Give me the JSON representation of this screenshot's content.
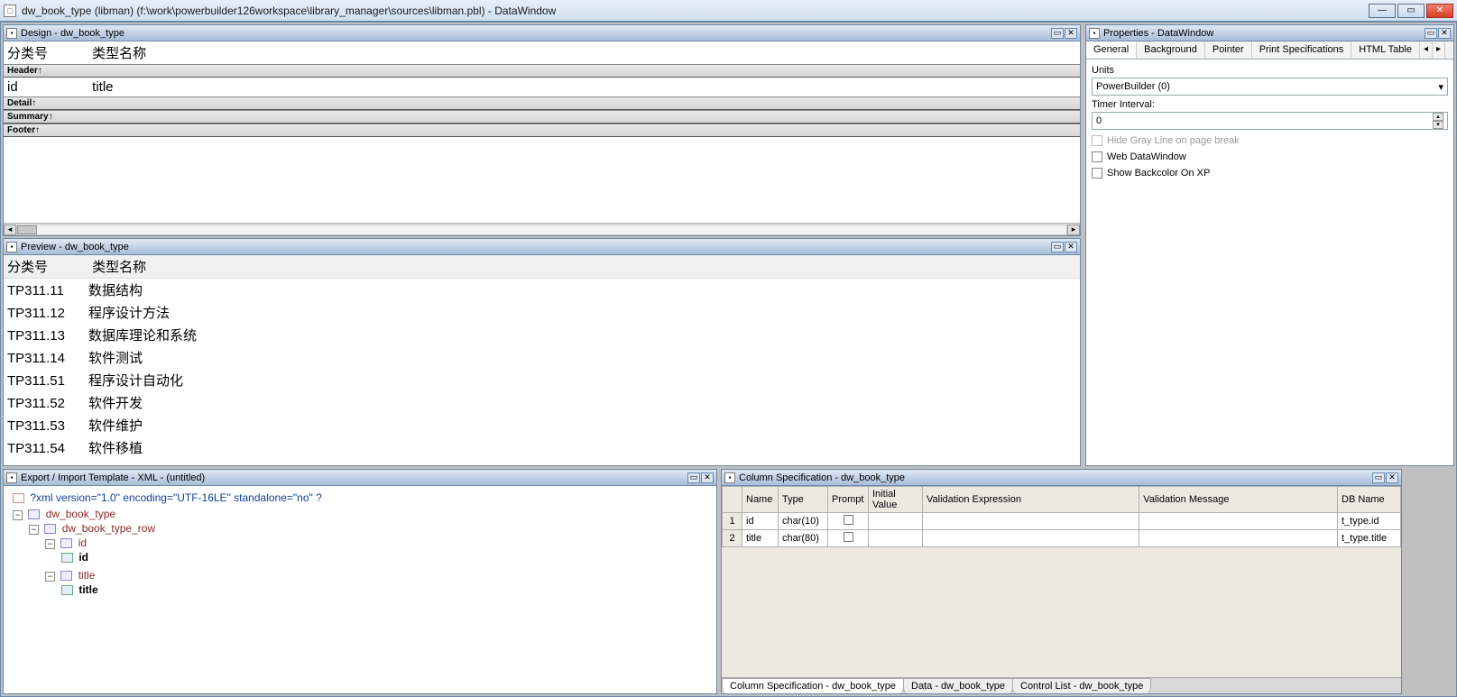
{
  "titlebar": {
    "title": "dw_book_type  (libman) (f:\\work\\powerbuilder126workspace\\library_manager\\sources\\libman.pbl) - DataWindow"
  },
  "design": {
    "panel_title": "Design - dw_book_type",
    "header": {
      "col1": "分类号",
      "col2": "类型名称"
    },
    "detail": {
      "col1": "id",
      "col2": "title"
    },
    "bands": {
      "header": "Header↑",
      "detail": "Detail↑",
      "summary": "Summary↑",
      "footer": "Footer↑"
    }
  },
  "preview": {
    "panel_title": "Preview - dw_book_type",
    "header": {
      "col1": "分类号",
      "col2": "类型名称"
    },
    "rows": [
      {
        "id": "TP311.11",
        "title": "数据结构"
      },
      {
        "id": "TP311.12",
        "title": "程序设计方法"
      },
      {
        "id": "TP311.13",
        "title": "数据库理论和系统"
      },
      {
        "id": "TP311.14",
        "title": "软件测试"
      },
      {
        "id": "TP311.51",
        "title": "程序设计自动化"
      },
      {
        "id": "TP311.52",
        "title": "软件开发"
      },
      {
        "id": "TP311.53",
        "title": "软件维护"
      },
      {
        "id": "TP311.54",
        "title": "软件移植"
      }
    ]
  },
  "properties": {
    "panel_title": "Properties - DataWindow",
    "tabs": {
      "general": "General",
      "background": "Background",
      "pointer": "Pointer",
      "print": "Print Specifications",
      "html": "HTML Table"
    },
    "units_label": "Units",
    "units_value": "PowerBuilder (0)",
    "timer_label": "Timer Interval:",
    "timer_value": "0",
    "hide_gray": "Hide Gray Line on page break",
    "web_dw": "Web DataWindow",
    "show_back": "Show Backcolor On XP"
  },
  "xml_panel": {
    "panel_title": "Export / Import Template - XML - (untitled)",
    "decl": "?xml version=\"1.0\" encoding=\"UTF-16LE\" standalone=\"no\" ?",
    "root": "dw_book_type",
    "row": "dw_book_type_row",
    "col1": "id",
    "col1_val": "id",
    "col2": "title",
    "col2_val": "title"
  },
  "colspec": {
    "panel_title": "Column Specification - dw_book_type",
    "headers": {
      "num": "",
      "name": "Name",
      "type": "Type",
      "prompt": "Prompt",
      "initial": "Initial Value",
      "validexpr": "Validation Expression",
      "validmsg": "Validation Message",
      "dbname": "DB Name"
    },
    "rows": [
      {
        "num": "1",
        "name": "id",
        "type": "char(10)",
        "dbname": "t_type.id"
      },
      {
        "num": "2",
        "name": "title",
        "type": "char(80)",
        "dbname": "t_type.title"
      }
    ],
    "tabs": {
      "colspec": "Column Specification - dw_book_type",
      "data": "Data - dw_book_type",
      "ctrl": "Control List - dw_book_type"
    }
  }
}
